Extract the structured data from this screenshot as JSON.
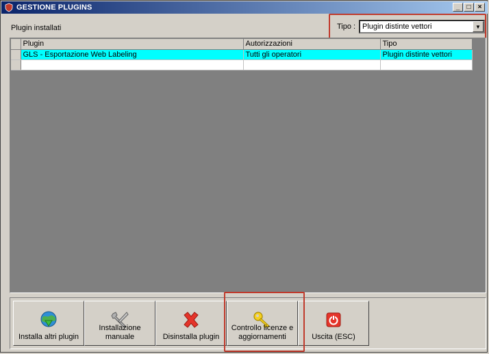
{
  "window": {
    "title": "GESTIONE PLUGINS",
    "controls": [
      "_",
      "□",
      "×"
    ]
  },
  "installed_label": "Plugin installati",
  "filter": {
    "label": "Tipo :",
    "selected": "Plugin distinte vettori"
  },
  "grid": {
    "columns": [
      "Plugin",
      "Autorizzazioni",
      "Tipo"
    ],
    "rows": [
      {
        "plugin": "GLS - Esportazione Web Labeling",
        "auth": "Tutti gli operatori",
        "tipo": "Plugin distinte vettori"
      }
    ]
  },
  "toolbar": {
    "install_other": "Installa altri plugin",
    "manual_install": "Installazione manuale",
    "uninstall": "Disinstalla plugin",
    "license_check": "Controllo licenze e aggiornamenti",
    "exit": "Uscita (ESC)"
  },
  "colors": {
    "highlight_box": "#c0392b",
    "selected_row": "#00ffff",
    "titlebar_start": "#0a246a",
    "titlebar_end": "#a6caf0"
  }
}
